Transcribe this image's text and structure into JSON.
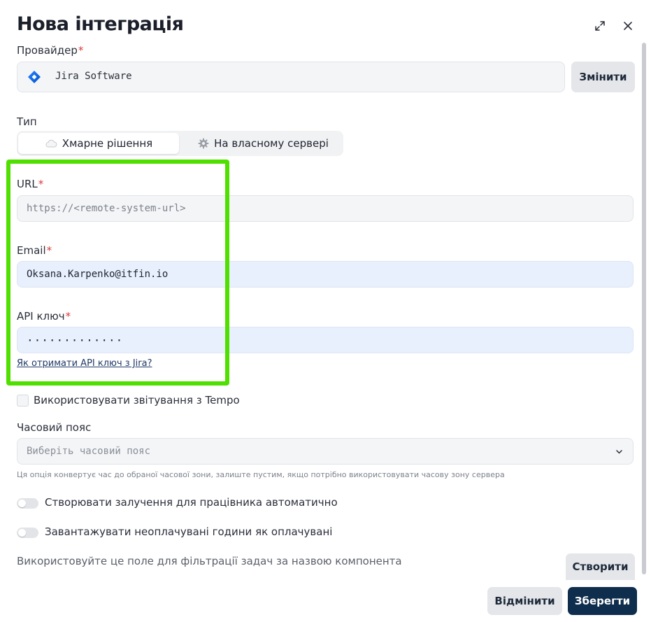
{
  "dialog": {
    "title": "Нова інтеграція"
  },
  "header_icons": [
    "expand-icon",
    "close-icon"
  ],
  "provider": {
    "label": "Провайдер",
    "required_mark": "*",
    "name": "Jira Software",
    "change_button": "Змінити",
    "icon": "jira-logo"
  },
  "type": {
    "label": "Тип",
    "options": [
      {
        "label": "Хмарне рішення",
        "icon": "cloud-icon",
        "selected": true
      },
      {
        "label": "На власному сервері",
        "icon": "gear-icon",
        "selected": false
      }
    ]
  },
  "url": {
    "label": "URL",
    "required_mark": "*",
    "placeholder": "https://<remote-system-url>",
    "value": ""
  },
  "email": {
    "label": "Email",
    "required_mark": "*",
    "value": "Oksana.Karpenko@itfin.io"
  },
  "api_key": {
    "label": "API ключ",
    "required_mark": "*",
    "masked_value": "·············",
    "help_link": "Як отримати API ключ з Jira?"
  },
  "tempo": {
    "label": "Використовувати звітування з Tempo",
    "checked": false
  },
  "timezone": {
    "label": "Часовий пояс",
    "placeholder": "Виберіть часовий пояс",
    "hint": "Ця опція конвертує час до обраної часової зони, залиште пустим, якщо потрібно використовувати часову зону сервера"
  },
  "toggles": [
    {
      "label": "Створювати залучення для працівника автоматично",
      "on": false
    },
    {
      "label": "Завантажувати неоплачувані години як оплачувані",
      "on": false
    }
  ],
  "component_filter": {
    "text": "Використовуйте це поле для фільтрації задач за назвою компонента",
    "create_button": "Створити"
  },
  "footer": {
    "cancel_button": "Відмінити",
    "save_button": "Зберегти"
  },
  "colors": {
    "primary": "#0f2d4c",
    "highlight": "#4fe000",
    "required": "#d93a3a",
    "autofill": "#e8f0fe"
  }
}
